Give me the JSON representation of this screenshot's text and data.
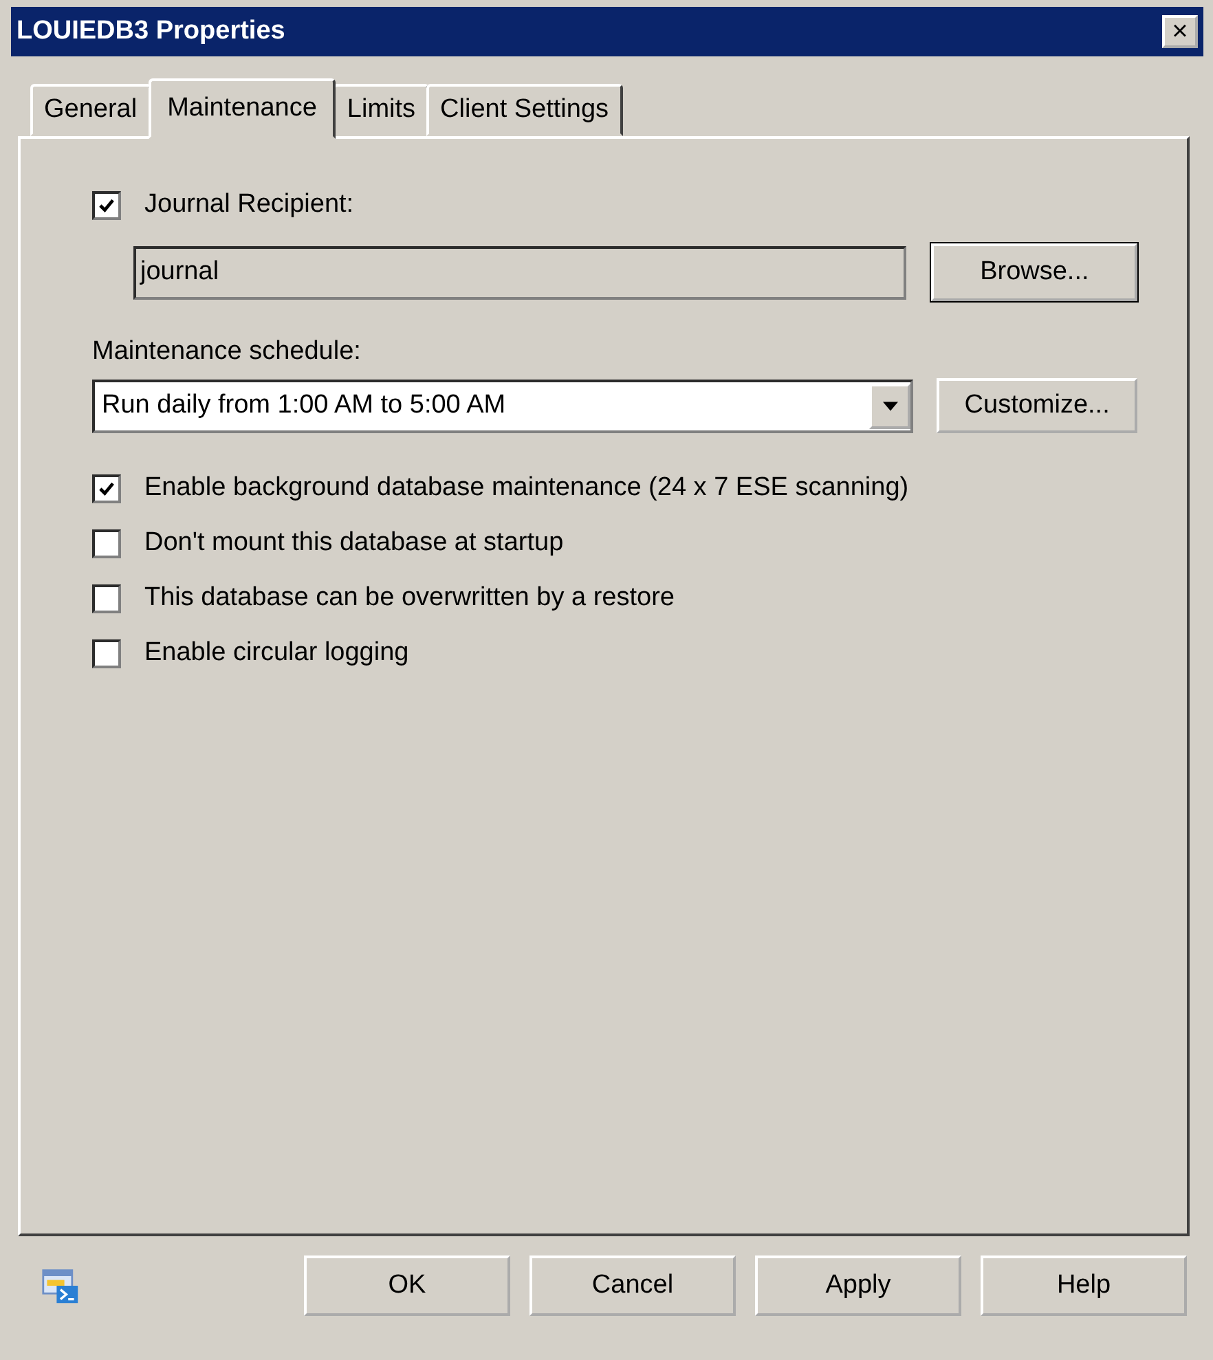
{
  "window": {
    "title": "LOUIEDB3 Properties",
    "close_glyph": "×"
  },
  "tabs": [
    {
      "label": "General",
      "selected": false
    },
    {
      "label": "Maintenance",
      "selected": true
    },
    {
      "label": "Limits",
      "selected": false
    },
    {
      "label": "Client Settings",
      "selected": false
    }
  ],
  "journal": {
    "label": "Journal Recipient:",
    "checked": true,
    "value": "journal",
    "browse_button": "Browse..."
  },
  "schedule": {
    "label": "Maintenance schedule:",
    "value": "Run daily from 1:00 AM to 5:00 AM",
    "customize_button": "Customize..."
  },
  "options": [
    {
      "label": "Enable background database maintenance (24 x 7 ESE scanning)",
      "checked": true
    },
    {
      "label": "Don't mount this database at startup",
      "checked": false
    },
    {
      "label": "This database can be overwritten by a restore",
      "checked": false
    },
    {
      "label": "Enable circular logging",
      "checked": false
    }
  ],
  "buttons": [
    "OK",
    "Cancel",
    "Apply",
    "Help"
  ]
}
